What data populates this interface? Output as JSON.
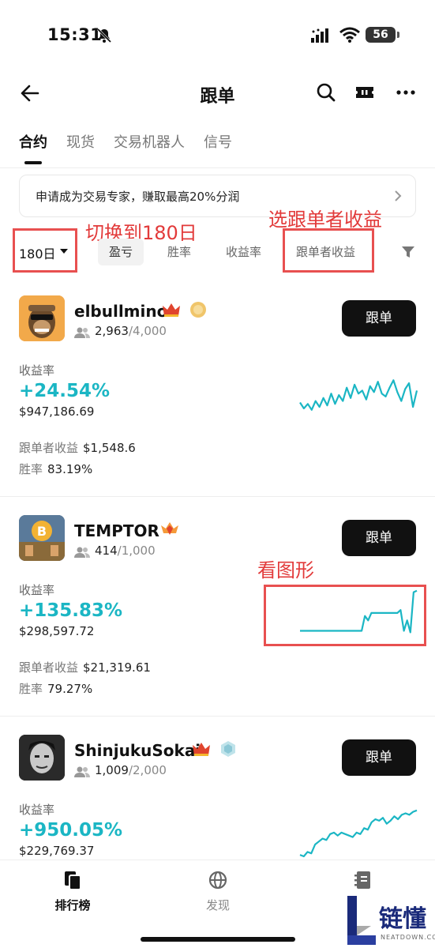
{
  "status_bar": {
    "time": "15:31",
    "battery": "56"
  },
  "nav": {
    "title": "跟单"
  },
  "tabs": [
    {
      "label": "合约",
      "active": true
    },
    {
      "label": "现货",
      "active": false
    },
    {
      "label": "交易机器人",
      "active": false
    },
    {
      "label": "信号",
      "active": false
    }
  ],
  "banner": {
    "text": "申请成为交易专家，赚取最高20%分润"
  },
  "filters": {
    "period": "180日",
    "chips": [
      "盈亏",
      "胜率",
      "收益率",
      "跟单者收益"
    ],
    "active_chip": "盈亏"
  },
  "annotations": {
    "switch_period": "切换到180日",
    "select_follower_profit": "选跟单者收益",
    "look_chart": "看图形"
  },
  "labels": {
    "roi": "收益率",
    "follower_profit": "跟单者收益",
    "win_rate": "胜率",
    "follow_button": "跟单"
  },
  "traders": [
    {
      "name": "elbullmino",
      "followers": "2,963",
      "capacity": "/4,000",
      "roi": "+24.54%",
      "aum": "$947,186.69",
      "follower_profit": "$1,548.6",
      "win_rate": "83.19%",
      "sparkline": [
        42,
        50,
        44,
        52,
        40,
        48,
        36,
        46,
        30,
        44,
        32,
        40,
        22,
        36,
        18,
        30,
        26,
        38,
        20,
        28,
        14,
        30,
        34,
        22,
        12,
        28,
        40,
        24,
        16,
        48,
        26
      ]
    },
    {
      "name": "TEMPTOR",
      "followers": "414",
      "capacity": "/1,000",
      "roi": "+135.83%",
      "aum": "$298,597.72",
      "follower_profit": "$21,319.61",
      "win_rate": "79.27%",
      "sparkline": [
        58,
        58,
        58,
        58,
        58,
        58,
        58,
        58,
        58,
        58,
        58,
        58,
        58,
        58,
        58,
        58,
        58,
        58,
        58,
        58,
        38,
        44,
        34,
        34,
        34,
        34,
        34,
        34,
        34,
        34,
        34,
        30,
        58,
        44,
        60,
        6,
        4
      ]
    },
    {
      "name": "ShinjukuSokai",
      "followers": "1,009",
      "capacity": "/2,000",
      "roi": "+950.05%",
      "aum": "$229,769.37",
      "sparkline": [
        64,
        66,
        60,
        62,
        50,
        46,
        42,
        44,
        36,
        34,
        38,
        34,
        36,
        38,
        40,
        34,
        36,
        28,
        30,
        20,
        16,
        18,
        14,
        22,
        18,
        12,
        16,
        10,
        8,
        10,
        6,
        4
      ]
    }
  ],
  "bottom_nav": [
    {
      "label": "排行榜",
      "icon": "leaderboard-icon",
      "active": true
    },
    {
      "label": "发现",
      "icon": "globe-icon",
      "active": false
    },
    {
      "label": "",
      "icon": "notebook-icon",
      "active": false
    }
  ],
  "watermark": {
    "text": "链懂",
    "sub": "NEATDOWN.COM"
  },
  "colors": {
    "accent": "#1bb6c4",
    "annotation": "#e23a3a",
    "button": "#111111"
  }
}
